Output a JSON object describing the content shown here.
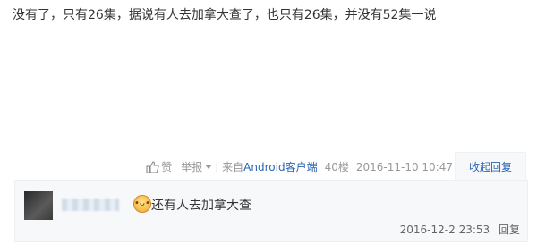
{
  "post": {
    "text": "没有了，只有26集，据说有人去加拿大查了，也只有26集，并没有52集一说"
  },
  "tail": {
    "like_label": "赞",
    "report_label": "举报",
    "from_prefix": "| 来自",
    "client_label": "Android客户端",
    "floor": "40楼",
    "time": "2016-11-10 10:47",
    "collapse_label": "收起回复"
  },
  "reply": {
    "text": "还有人去加拿大查",
    "time": "2016-12-2 23:53",
    "reply_label": "回复"
  },
  "colors": {
    "link": "#2d64b3",
    "panel_bg": "#f7f8fa"
  }
}
